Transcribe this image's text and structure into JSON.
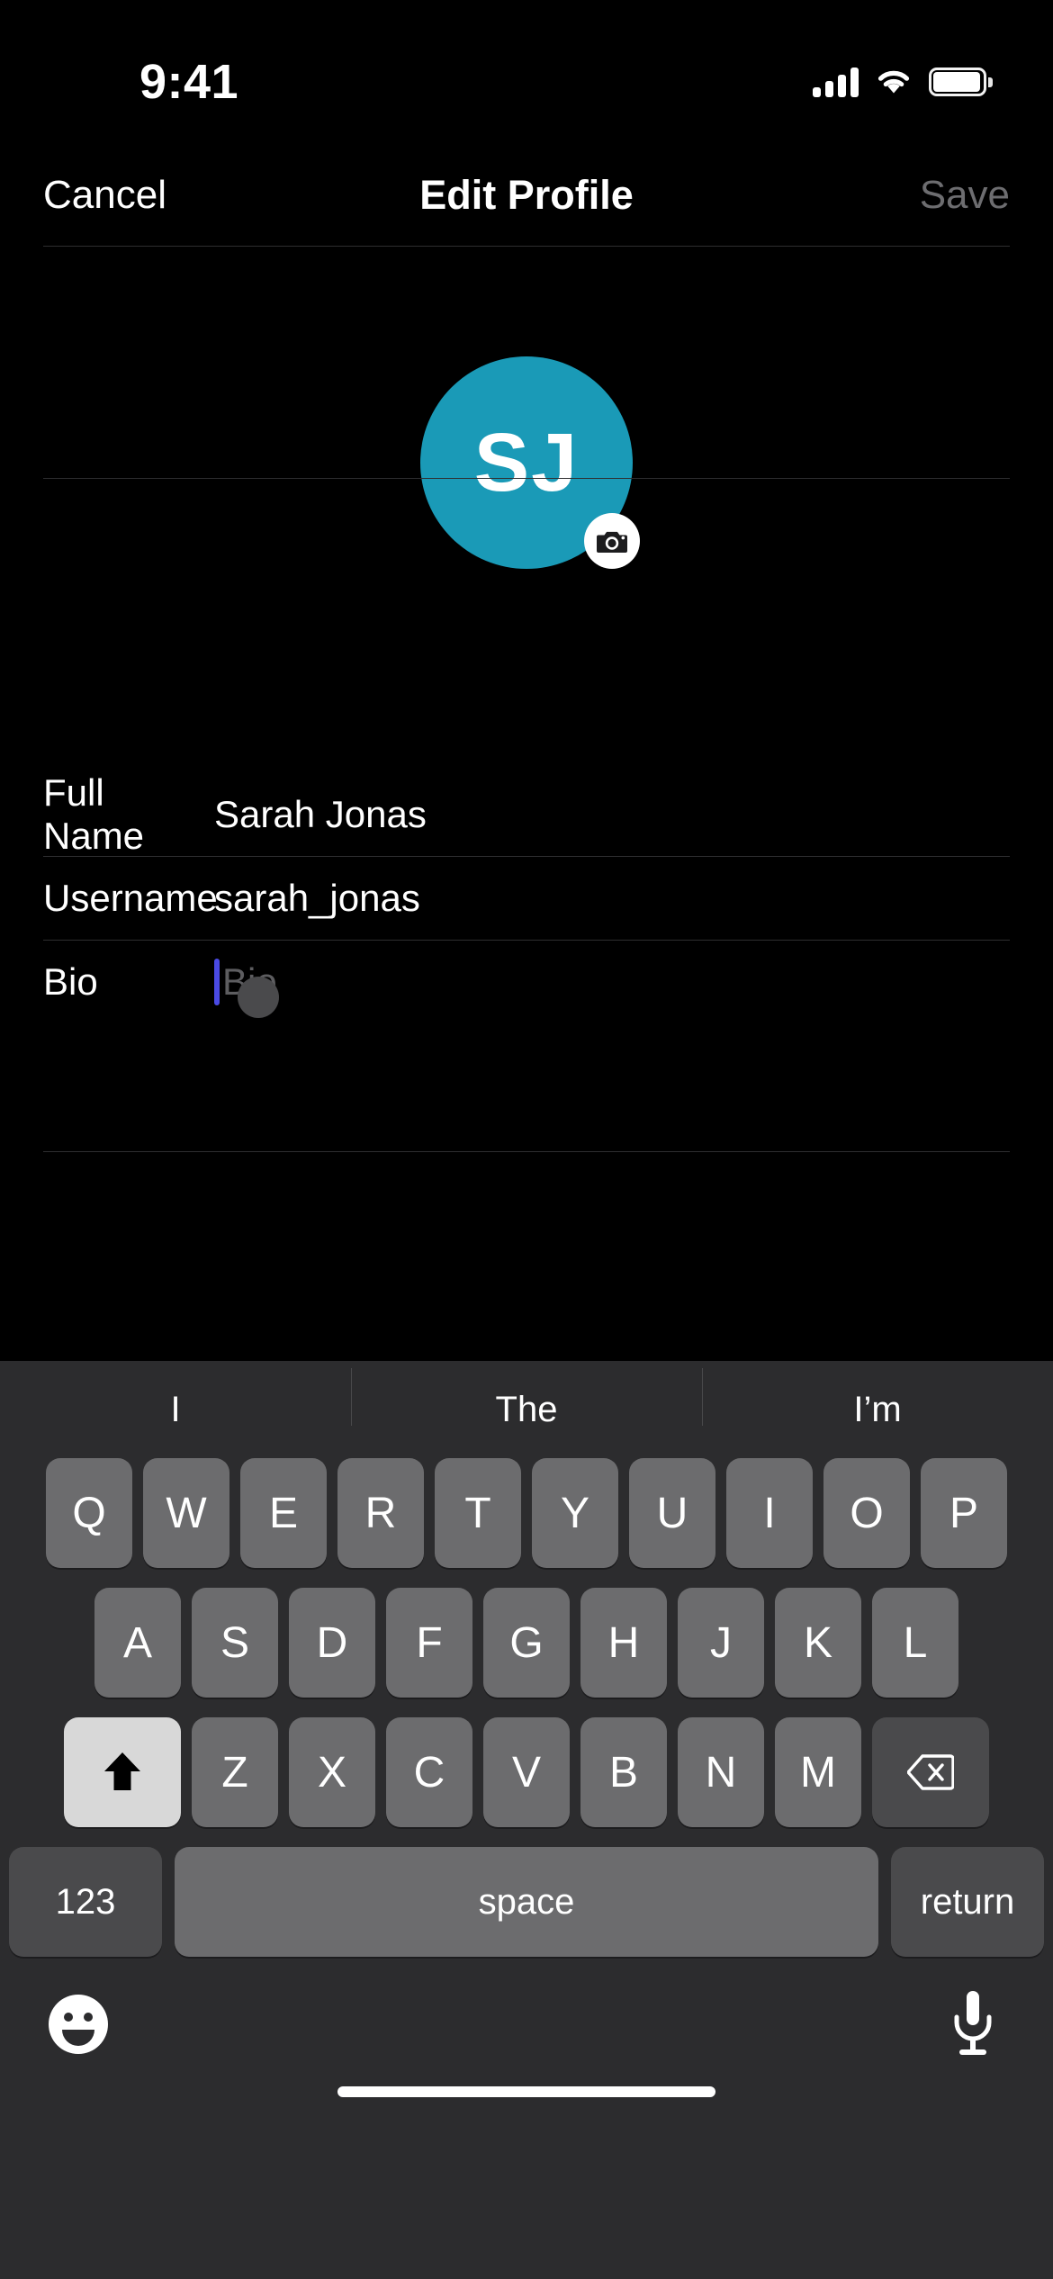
{
  "status_bar": {
    "time": "9:41",
    "cellular_icon": "cellular-signal-icon",
    "wifi_icon": "wifi-icon",
    "battery_icon": "battery-icon"
  },
  "nav": {
    "cancel_label": "Cancel",
    "title": "Edit Profile",
    "save_label": "Save",
    "save_color": "#6d6d70"
  },
  "avatar": {
    "initials": "SJ",
    "background_color": "#1a9ab7",
    "camera_badge_icon": "camera-icon"
  },
  "form": {
    "rows": [
      {
        "label": "Full Name",
        "value": "Sarah Jonas",
        "placeholder": "",
        "focused": false
      },
      {
        "label": "Username",
        "value": "sarah_jonas",
        "placeholder": "",
        "focused": false
      },
      {
        "label": "Bio",
        "value": "",
        "placeholder": "Bio",
        "focused": true
      }
    ],
    "caret_color": "#4a4ae4"
  },
  "keyboard": {
    "predictions": [
      "I",
      "The",
      "I’m"
    ],
    "row1": [
      "Q",
      "W",
      "E",
      "R",
      "T",
      "Y",
      "U",
      "I",
      "O",
      "P"
    ],
    "row2": [
      "A",
      "S",
      "D",
      "F",
      "G",
      "H",
      "J",
      "K",
      "L"
    ],
    "row3": [
      "Z",
      "X",
      "C",
      "V",
      "B",
      "N",
      "M"
    ],
    "shift_icon": "shift-arrow-icon",
    "shift_active": true,
    "backspace_icon": "backspace-icon",
    "numbers_label": "123",
    "space_label": "space",
    "return_label": "return",
    "emoji_icon": "emoji-smiley-icon",
    "dictation_icon": "microphone-icon",
    "key_color": "#6c6c6e",
    "modifier_key_color": "#4a4a4c",
    "shift_active_color": "#d8d8d8",
    "background_color": "#2c2c2e"
  }
}
